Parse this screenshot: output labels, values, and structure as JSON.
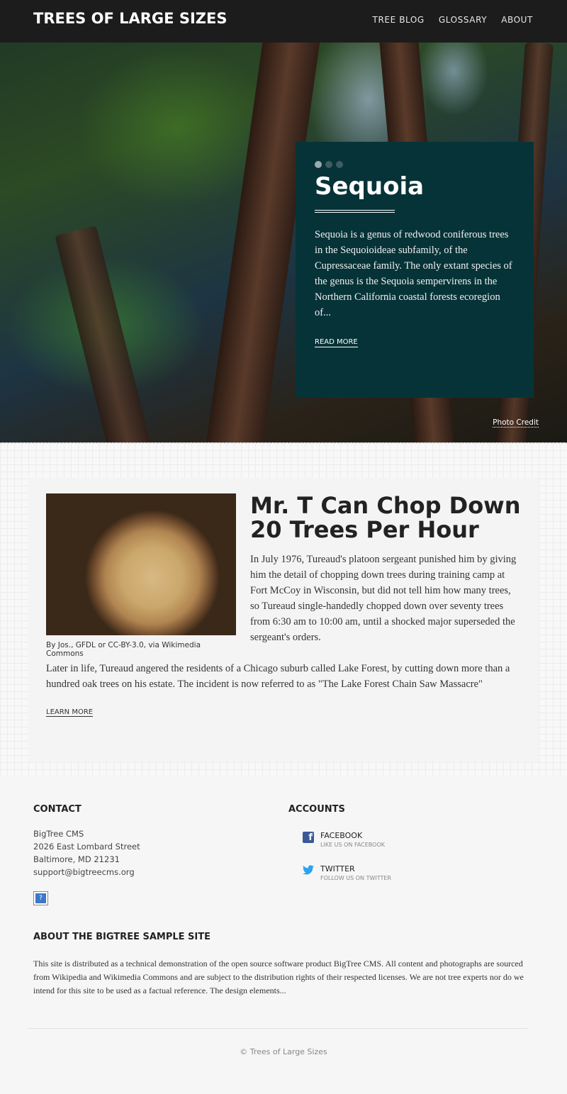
{
  "header": {
    "site_title": "TREES OF LARGE SIZES",
    "nav": [
      "TREE BLOG",
      "GLOSSARY",
      "ABOUT"
    ]
  },
  "hero": {
    "slide_count": 3,
    "active_slide": 1,
    "title": "Sequoia",
    "text": "Sequoia is a genus of redwood coniferous trees in the Sequoioideae subfamily, of the Cupressaceae family. The only extant species of the genus is the Sequoia sempervirens in the Northern California coastal forests ecoregion of...",
    "read_more": "READ MORE",
    "photo_credit": "Photo Credit",
    "card_color": "#063338"
  },
  "article": {
    "image_alt": "cut log",
    "caption": "By Jos., GFDL or CC-BY-3.0, via Wikimedia Commons",
    "title": "Mr. T Can Chop Down 20 Trees Per Hour",
    "paragraph1": "In July 1976, Tureaud's platoon sergeant punished him by giving him the detail of chopping down trees during training camp at Fort McCoy in Wisconsin, but did not tell him how many trees, so Tureaud single-handedly chopped down over seventy trees from 6:30 am to 10:00 am, until a shocked major superseded the sergeant's orders.",
    "paragraph2": "Later in life, Tureaud angered the residents of a Chicago suburb called Lake Forest, by cutting down more than a hundred oak trees on his estate. The incident is now referred to as \"The Lake Forest Chain Saw Massacre\"",
    "learn_more": "LEARN MORE"
  },
  "footer": {
    "contact": {
      "title": "CONTACT",
      "name": "BigTree CMS",
      "street": "2026 East Lombard Street",
      "city": "Baltimore, MD 21231",
      "email": "support@bigtreecms.org"
    },
    "accounts": {
      "title": "ACCOUNTS",
      "items": [
        {
          "icon": "facebook-icon",
          "name": "FACEBOOK",
          "sub": "LIKE US ON FACEBOOK"
        },
        {
          "icon": "twitter-icon",
          "name": "TWITTER",
          "sub": "FOLLOW US ON TWITTER"
        }
      ]
    },
    "about": {
      "title": "ABOUT THE BIGTREE SAMPLE SITE",
      "text": "This site is distributed as a technical demonstration of the open source software product BigTree CMS. All content and photographs are sourced from Wikipedia and Wikimedia Commons and are subject to the distribution rights of their respected licenses. We are not tree experts nor do we intend for this site to be used as a factual reference. The design elements..."
    },
    "copyright": "© Trees of Large Sizes"
  }
}
